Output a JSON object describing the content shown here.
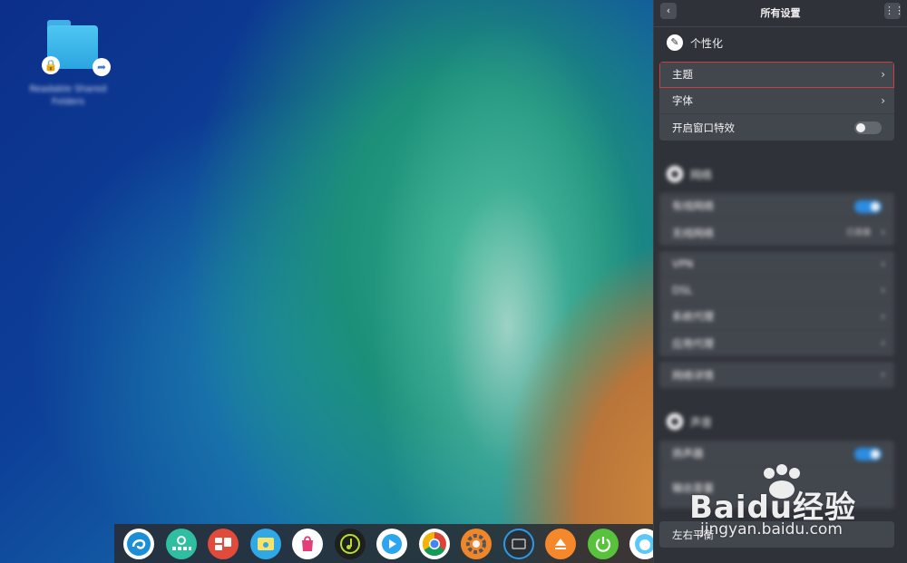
{
  "desktop": {
    "folder_label": "Readable Shared Folders"
  },
  "panel": {
    "title": "所有设置",
    "back_icon": "chevron-left-icon",
    "grid_icon": "grid-icon",
    "personalization": {
      "section_label": "个性化",
      "icon": "palette-icon",
      "rows": [
        {
          "label": "主题",
          "control": "chevron"
        },
        {
          "label": "字体",
          "control": "chevron"
        },
        {
          "label": "开启窗口特效",
          "control": "toggle",
          "state": false
        }
      ]
    },
    "network": {
      "section_label": "网络",
      "group1": [
        {
          "label": "有线网络",
          "control": "toggle",
          "state": true
        },
        {
          "label": "无线网络",
          "control": "value",
          "value": "已连接"
        }
      ],
      "group2": [
        {
          "label": "VPN",
          "control": "chevron"
        },
        {
          "label": "DSL",
          "control": "chevron"
        },
        {
          "label": "系统代理",
          "control": "chevron"
        },
        {
          "label": "应用代理",
          "control": "chevron"
        }
      ],
      "group3": [
        {
          "label": "网络详情",
          "control": "chevron"
        }
      ]
    },
    "sound": {
      "section_label": "声音",
      "rows": [
        {
          "label": "扬声器",
          "control": "toggle",
          "state": true
        },
        {
          "label": "输出音量",
          "control": "slider"
        }
      ]
    },
    "bottom_label": "左右平衡"
  },
  "dock": {
    "items": [
      {
        "name": "launcher-icon",
        "color": "#ffffff"
      },
      {
        "name": "multitasking-icon",
        "color": "#2dbf9f"
      },
      {
        "name": "workspace-icon",
        "color": "#e24a3b"
      },
      {
        "name": "file-manager-icon",
        "color": "#2fa8e6"
      },
      {
        "name": "app-store-icon",
        "color": "#ffffff"
      },
      {
        "name": "music-icon",
        "color": "#1f1f1f"
      },
      {
        "name": "video-icon",
        "color": "#2ba5f0"
      },
      {
        "name": "chrome-icon",
        "color": "#ffffff"
      },
      {
        "name": "settings-icon",
        "color": "#f0862a"
      },
      {
        "name": "monitor-icon",
        "color": "#2a2f36"
      },
      {
        "name": "eject-icon",
        "color": "#f5882b"
      },
      {
        "name": "power-icon",
        "color": "#59c23c"
      },
      {
        "name": "assistant-icon",
        "color": "#ffffff"
      }
    ]
  },
  "watermark": {
    "brand": "Baidu经验",
    "url": "jingyan.baidu.com"
  }
}
